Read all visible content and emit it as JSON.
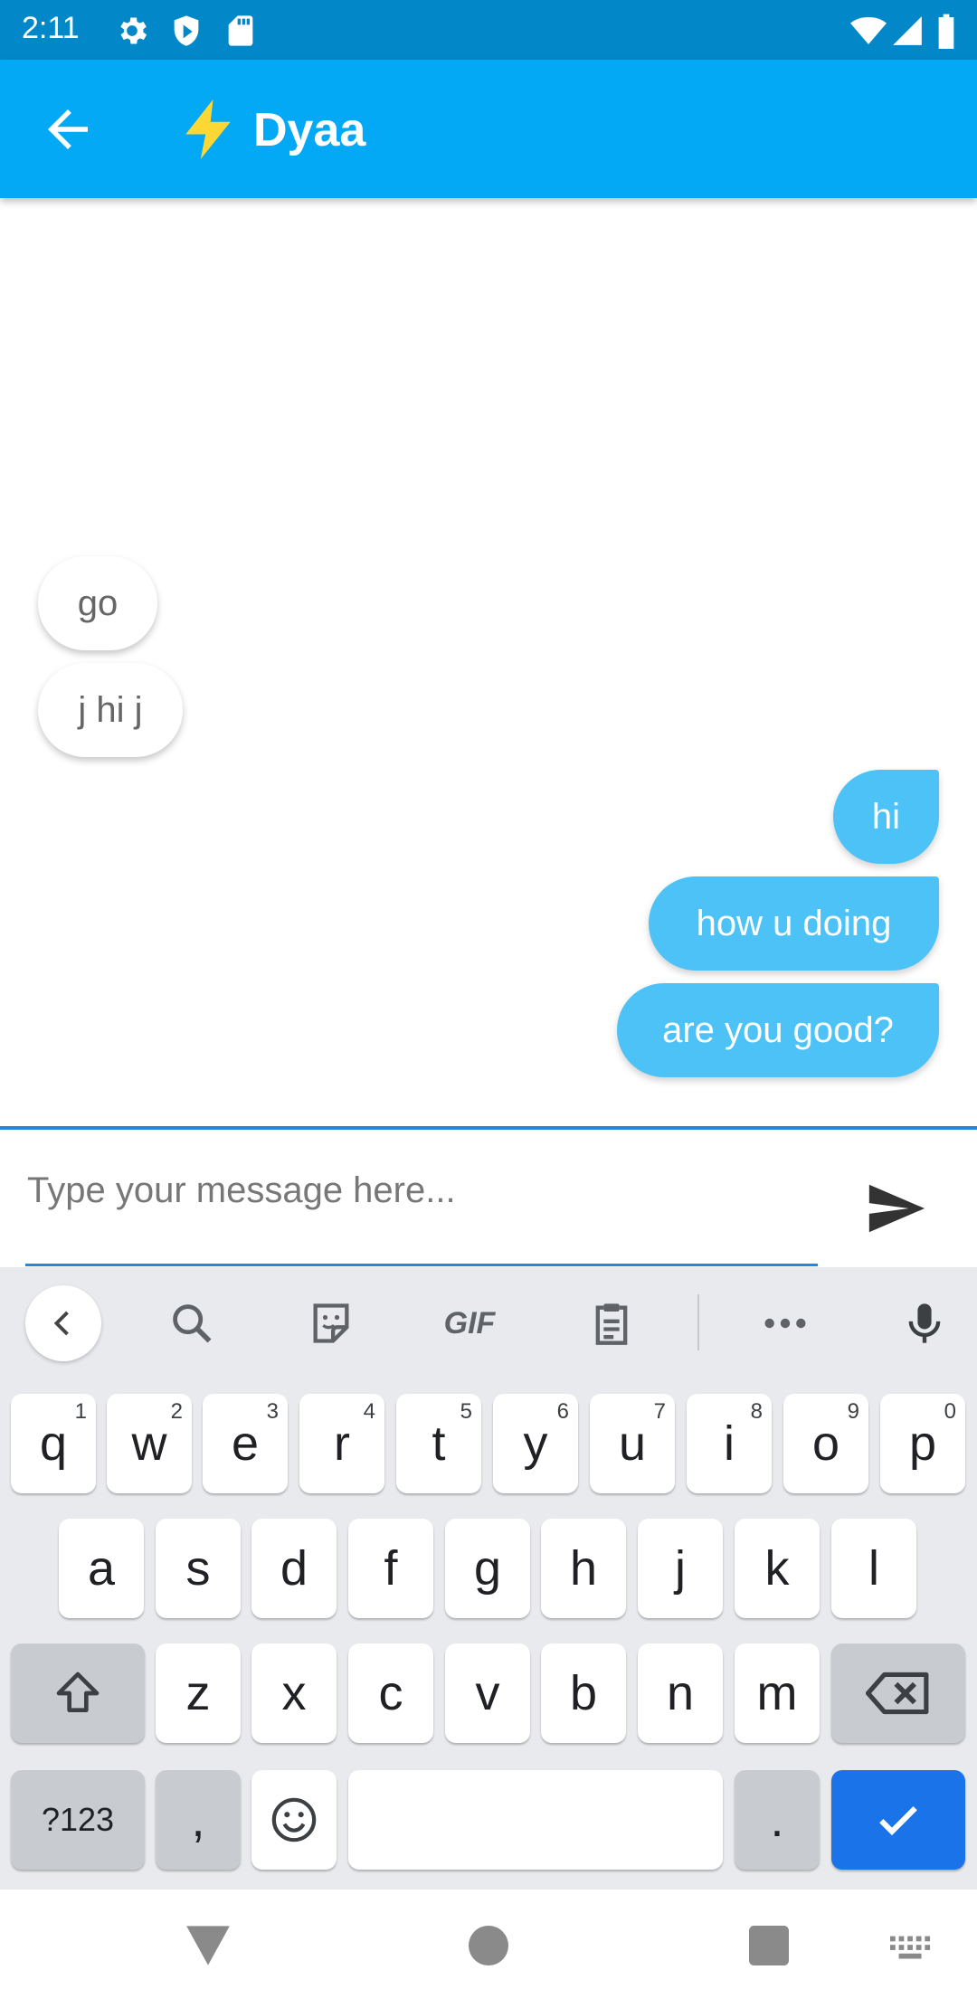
{
  "status_bar": {
    "time": "2:11"
  },
  "header": {
    "title": "Dyaa"
  },
  "messages": {
    "incoming": [
      "go",
      "j hi j"
    ],
    "outgoing": [
      "hi",
      "how u doing",
      "are you good?"
    ]
  },
  "composer": {
    "placeholder": "Type your message here..."
  },
  "keyboard": {
    "toolbar": {
      "gif_label": "GIF"
    },
    "row1": [
      {
        "key": "q",
        "sup": "1"
      },
      {
        "key": "w",
        "sup": "2"
      },
      {
        "key": "e",
        "sup": "3"
      },
      {
        "key": "r",
        "sup": "4"
      },
      {
        "key": "t",
        "sup": "5"
      },
      {
        "key": "y",
        "sup": "6"
      },
      {
        "key": "u",
        "sup": "7"
      },
      {
        "key": "i",
        "sup": "8"
      },
      {
        "key": "o",
        "sup": "9"
      },
      {
        "key": "p",
        "sup": "0"
      }
    ],
    "row2": [
      "a",
      "s",
      "d",
      "f",
      "g",
      "h",
      "j",
      "k",
      "l"
    ],
    "row3": [
      "z",
      "x",
      "c",
      "v",
      "b",
      "n",
      "m"
    ],
    "bottom": {
      "symbols_label": "?123",
      "comma_label": ",",
      "period_label": "."
    }
  },
  "colors": {
    "app_bar": "#03a9f4",
    "status_bar": "#0288c9",
    "outgoing_bubble": "#4dc2f6",
    "accent": "#1e88e5",
    "done_key": "#1a73e8"
  }
}
